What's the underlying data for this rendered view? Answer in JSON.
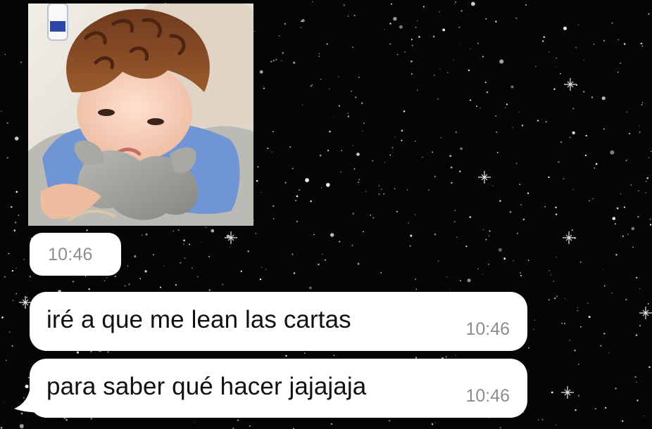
{
  "chat": {
    "image_message": {
      "time": "10:46",
      "photo_alt": "photo"
    },
    "messages": [
      {
        "text": "iré a que me lean las cartas",
        "time": "10:46"
      },
      {
        "text": "para saber qué hacer jajajaja",
        "time": "10:46"
      }
    ]
  },
  "colors": {
    "background": "#050505",
    "bubble": "#ffffff",
    "message_text": "#111111",
    "timestamp": "#8d8d91"
  }
}
